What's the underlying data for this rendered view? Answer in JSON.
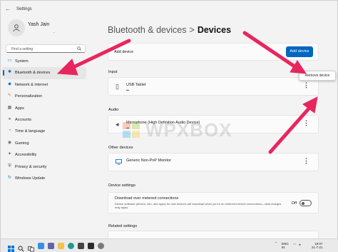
{
  "window": {
    "back_glyph": "←",
    "title": "Settings"
  },
  "profile": {
    "name": "Yash Jain",
    "email_hint": "-"
  },
  "search": {
    "placeholder": "Find a setting"
  },
  "nav": {
    "items": [
      {
        "label": "System",
        "icon": "monitor-icon",
        "color": "#0078d4",
        "glyph": "▭"
      },
      {
        "label": "Bluetooth & devices",
        "icon": "bluetooth-icon",
        "color": "#0067c0",
        "glyph": "✱"
      },
      {
        "label": "Network & internet",
        "icon": "wifi-icon",
        "color": "#0078d4",
        "glyph": "◆"
      },
      {
        "label": "Personalization",
        "icon": "brush-icon",
        "color": "#d87a16",
        "glyph": "✎"
      },
      {
        "label": "Apps",
        "icon": "apps-icon",
        "color": "#5c5c5c",
        "glyph": "▦"
      },
      {
        "label": "Accounts",
        "icon": "account-icon",
        "color": "#2e9e5a",
        "glyph": "●"
      },
      {
        "label": "Time & language",
        "icon": "clock-globe-icon",
        "color": "#0078d4",
        "glyph": "◔"
      },
      {
        "label": "Gaming",
        "icon": "gamepad-icon",
        "color": "#6b6b6b",
        "glyph": "◉"
      },
      {
        "label": "Accessibility",
        "icon": "accessibility-icon",
        "color": "#1f5fbf",
        "glyph": "✦"
      },
      {
        "label": "Privacy & security",
        "icon": "shield-icon",
        "color": "#5c5c5c",
        "glyph": "⛨"
      },
      {
        "label": "Windows Update",
        "icon": "update-icon",
        "color": "#0078d4",
        "glyph": "↻"
      }
    ],
    "active_index": 1
  },
  "header": {
    "parent": "Bluetooth & devices",
    "separator": ">",
    "current": "Devices"
  },
  "add_device": {
    "label": "Add device",
    "button": "Add device"
  },
  "sections": {
    "input": "Input",
    "audio": "Audio",
    "other": "Other devices",
    "device_settings": "Device settings",
    "related": "Related settings"
  },
  "devices": {
    "input": {
      "name": "USB Tablet",
      "icon": "pen-tablet-icon"
    },
    "audio": {
      "name": "Microphone (High Definition Audio Device)",
      "icon": "speaker-icon"
    },
    "other": {
      "name": "Generic Non-PnP Monitor",
      "icon": "monitor-icon"
    }
  },
  "more_glyph": "⋮",
  "context_menu": {
    "item": "Remove device"
  },
  "download_setting": {
    "title": "Download over metered connections",
    "description": "Device software (drivers, info, and apps) for new devices will download when you're on metered internet connections—data charges may apply",
    "toggle_label": "Off",
    "toggle_state": "off"
  },
  "watermark": {
    "text": "WPXBOX"
  },
  "taskbar": {
    "tray_left": "ENG\nIN",
    "time": "19:07",
    "date": "21-7-21",
    "icons": [
      "windows-start-icon",
      "search-icon",
      "task-view-icon",
      "widgets-icon",
      "chat-icon",
      "file-explorer-icon",
      "edge-icon",
      "store-icon",
      "terminal-icon",
      "settings-icon"
    ]
  },
  "colors": {
    "accent": "#0067c0",
    "arrow": "#e8265e",
    "status_connected": "#2e8b57"
  }
}
